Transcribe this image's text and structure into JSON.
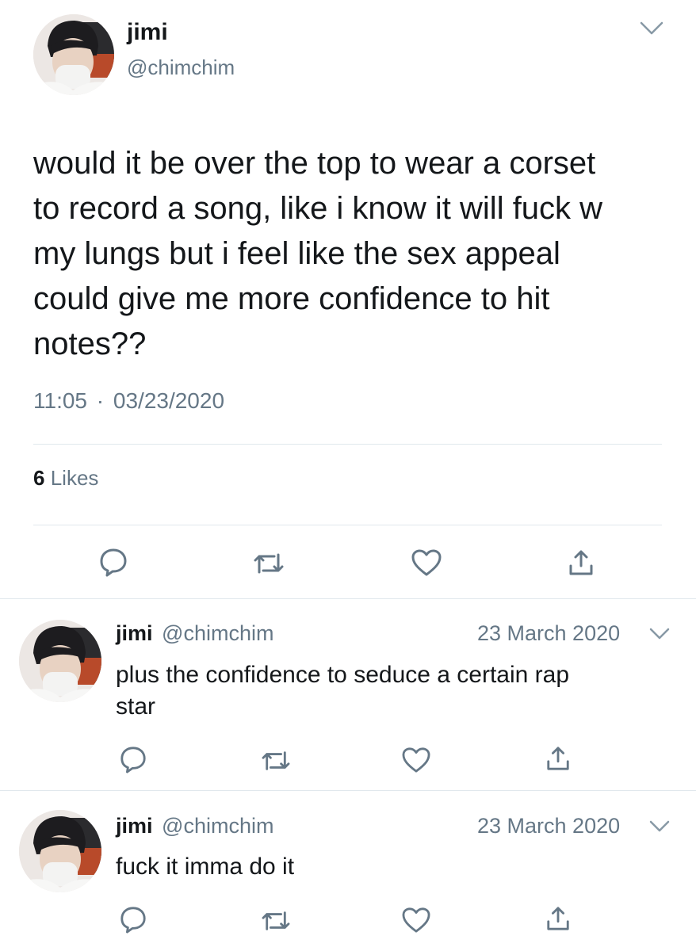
{
  "main_tweet": {
    "author_name": "jimi",
    "author_handle": "@chimchim",
    "text_lines": [
      "would it be over the top to wear a corset",
      "to record a song, like i know it will fuck w",
      "my lungs but i feel like the sex appeal",
      "could give me more confidence to hit",
      "notes??"
    ],
    "time": "11:05",
    "separator": "·",
    "date": "03/23/2020",
    "likes_count": "6",
    "likes_label": "Likes"
  },
  "replies": [
    {
      "author_name": "jimi",
      "author_handle": "@chimchim",
      "date": "23 March 2020",
      "text_lines": [
        "plus the confidence to seduce a certain rap",
        "star"
      ]
    },
    {
      "author_name": "jimi",
      "author_handle": "@chimchim",
      "date": "23 March 2020",
      "text_lines": [
        "fuck it imma do it"
      ]
    }
  ],
  "icons": {
    "reply": "speech-bubble-icon",
    "retweet": "retweet-icon",
    "like": "heart-icon",
    "share": "share-icon",
    "menu": "chevron-down-icon"
  },
  "colors": {
    "icon": "#657786",
    "divider": "#e1e8ed",
    "text": "#14171a"
  }
}
